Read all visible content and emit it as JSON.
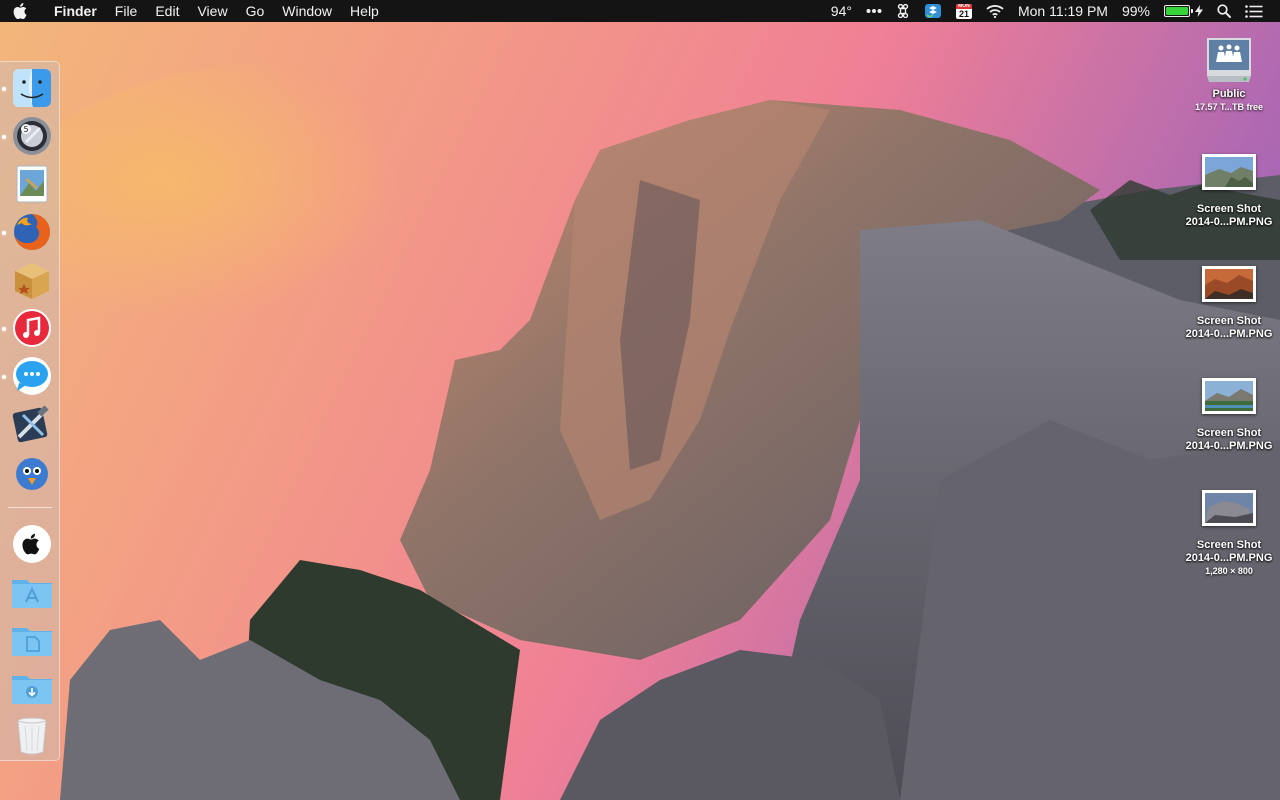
{
  "menubar": {
    "apple_icon": "apple-icon",
    "app_name": "Finder",
    "menus": [
      "File",
      "Edit",
      "View",
      "Go",
      "Window",
      "Help"
    ],
    "status": {
      "temperature": "94°",
      "more_icon": "ellipsis-icon",
      "command_icon": "command-icon",
      "dropbox_icon": "dropbox-icon",
      "calendar": {
        "month": "MON",
        "day": "21"
      },
      "wifi_icon": "wifi-icon",
      "clock": "Mon 11:19 PM",
      "battery_percent": "99%",
      "battery_level": 0.99,
      "charging_icon": "bolt-icon",
      "spotlight_icon": "search-icon",
      "notification_icon": "list-icon"
    }
  },
  "dock": {
    "items": [
      {
        "name": "finder",
        "icon": "finder-icon",
        "running": true
      },
      {
        "name": "launchpad",
        "icon": "launchpad-icon",
        "running": true
      },
      {
        "name": "preview",
        "icon": "preview-icon",
        "running": false
      },
      {
        "name": "firefox",
        "icon": "firefox-icon",
        "running": true
      },
      {
        "name": "archive",
        "icon": "box-icon",
        "running": false
      },
      {
        "name": "itunes",
        "icon": "itunes-icon",
        "running": true
      },
      {
        "name": "messages",
        "icon": "messages-icon",
        "running": true
      },
      {
        "name": "xcode",
        "icon": "xcode-icon",
        "running": false
      },
      {
        "name": "tweetbot",
        "icon": "bird-icon",
        "running": false
      },
      {
        "name": "apple-site",
        "icon": "apple-badge-icon",
        "running": false
      },
      {
        "name": "applications-folder",
        "icon": "appstore-folder-icon",
        "running": false
      },
      {
        "name": "documents-folder",
        "icon": "document-folder-icon",
        "running": false
      },
      {
        "name": "downloads-folder",
        "icon": "download-folder-icon",
        "running": false
      },
      {
        "name": "trash",
        "icon": "trash-icon",
        "running": false
      }
    ]
  },
  "desktop": {
    "items": [
      {
        "label": "Public",
        "sub": "17.57 T...TB free",
        "icon": "network-drive-icon"
      },
      {
        "label": "Screen Shot",
        "label2": "2014-0...PM.PNG",
        "icon": "screenshot-thumb-icon"
      },
      {
        "label": "Screen Shot",
        "label2": "2014-0...PM.PNG",
        "icon": "screenshot-thumb-icon"
      },
      {
        "label": "Screen Shot",
        "label2": "2014-0...PM.PNG",
        "icon": "screenshot-thumb-icon"
      },
      {
        "label": "Screen Shot",
        "label2": "2014-0...PM.PNG",
        "sub": "1,280 × 800",
        "icon": "screenshot-thumb-icon"
      }
    ]
  }
}
